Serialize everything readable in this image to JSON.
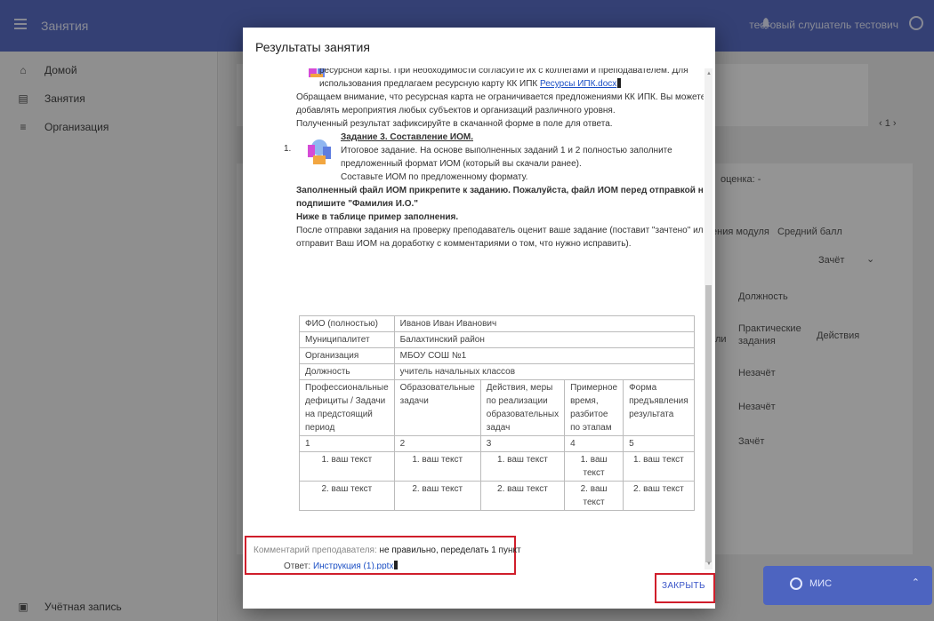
{
  "topbar": {
    "title": "Занятия",
    "user_name": "тестовый слушатель тестович"
  },
  "sidebar": {
    "items": [
      {
        "label": "Домой",
        "icon": "home-icon"
      },
      {
        "label": "Занятия",
        "icon": "calendar-icon"
      },
      {
        "label": "Организация",
        "icon": "list-icon"
      }
    ],
    "account_label": "Учётная запись"
  },
  "background": {
    "pager": "1",
    "grade_label": "оценка:",
    "grade_value": "-",
    "col_module": "ения модуля",
    "col_avg": "Средний балл",
    "zachet": "Зачёт",
    "position_label": "Должность",
    "practical": "Практические",
    "tasks": "задания",
    "actions": "Действия",
    "row_prefix": "ли",
    "rows": [
      "Незачёт",
      "Незачёт",
      "Зачёт"
    ]
  },
  "chat": {
    "label": "МИС"
  },
  "modal": {
    "title": "Результаты занятия",
    "lines": {
      "l1": "ресурсной карты. При необходимости согласуйте их с коллегами и преподавателем. Для",
      "l2_pre": "использования предлагаем ресурсную карту КК ИПК ",
      "l2_link": "Ресурсы ИПК.docx",
      "l3": "Обращаем внимание, что ресурсная карта не ограничивается предложениями КК ИПК. Вы можете",
      "l4": "добавлять мероприятия любых субъектов и организаций различного уровня.",
      "l5": "Полученный результат зафиксируйте в скачанной форме в поле для ответа.",
      "task_title": "Задание 3. Составление ИОМ.",
      "num": "1.",
      "t1": "Итоговое задание. На основе выполненных заданий 1 и 2 полностью заполните",
      "t2": "предложенный формат ИОМ (который вы скачали ранее).",
      "t3": "Составьте ИОМ по предложенному формату.",
      "b1": "Заполненный файл ИОМ прикрепите к заданию. Пожалуйста, файл ИОМ перед отправкой на проверку",
      "b2": "подпишите \"Фамилия И.О.\"",
      "b3": "Ниже в таблице пример заполнения.",
      "p1": "После отправки задания на проверку преподаватель оценит ваше задание (поставит \"зачтено\" или",
      "p2": "отправит Ваш ИОМ на доработку с комментариями о том, что нужно исправить)."
    },
    "table": {
      "fio_label": "ФИО (полностью)",
      "fio_value": "Иванов Иван Иванович",
      "mun_label": "Муниципалитет",
      "mun_value": "Балахтинский район",
      "org_label": "Организация",
      "org_value": "МБОУ СОШ №1",
      "pos_label": "Должность",
      "pos_value": "учитель начальных классов",
      "headers": [
        "Профессиональные дефициты / Задачи на предстоящий период",
        "Образовательные задачи",
        "Действия, меры по реализации образовательных задач",
        "Примерное время, разбитое по этапам",
        "Форма предъявления результата"
      ],
      "numbers": [
        "1",
        "2",
        "3",
        "4",
        "5"
      ],
      "row1": [
        "1. ваш текст",
        "1. ваш текст",
        "1. ваш текст",
        "1. ваш текст",
        "1. ваш текст"
      ],
      "row2": [
        "2. ваш текст",
        "2. ваш текст",
        "2. ваш текст",
        "2. ваш текст",
        "2. ваш текст"
      ]
    },
    "answer_label": "Ответ:",
    "answer_file": "Инструкция (1).pptx",
    "comment_label": "Комментарий преподавателя:",
    "comment_value": "не правильно, переделать 1 пункт",
    "close_label": "ЗАКРЫТЬ"
  }
}
